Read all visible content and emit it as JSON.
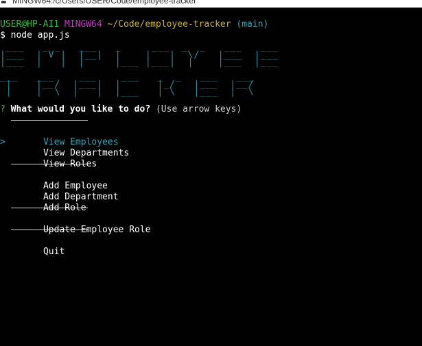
{
  "window": {
    "title": "MINGW64:/c/Users/USER/Code/employee-tracker",
    "icon": "terminal-icon"
  },
  "colors": {
    "background": "#000000",
    "user": "#27c13a",
    "mingw": "#c33bc3",
    "path": "#c8b42f",
    "branch": "#2ea5b8",
    "ascii": "#2a8fa3",
    "selected": "#2ea5b8",
    "question_mark": "#27c13a",
    "text": "#ffffff",
    "hint": "#d0d0d0"
  },
  "prompt": {
    "user_host": "USER@HP-AI1",
    "system": "MINGW64",
    "path": "~/Code/employee-tracker",
    "branch": "(main)",
    "symbol": "$",
    "command": "node app.js"
  },
  "banner": {
    "word1_ascii": " ___   _ _   ___   _     ___  _  _   ___   ___ \n|___  | V |  |__|  |    |   |  \\/   |___  |___ \n|___  |   |  |     |___ |___|  |    |___  |___ ",
    "word2_ascii": "___   ___    ___    ___   _  _   ___   ___ \n |    |__/  |___|  |      |_/   |___  |__/ \n |    |  \\  |   |  |___   | \\   |___  |  \\ "
  },
  "question": {
    "marker": "?",
    "text": "What would you like to do?",
    "hint": "(Use arrow keys)"
  },
  "menu": {
    "pointer": ">",
    "view_employees": "View Employees",
    "view_departments": "View Departments",
    "view_roles": "View Roles",
    "add_employee": "Add Employee",
    "add_department": "Add Department",
    "add_role": "Add Role",
    "update_employee_role": "Update Employee Role",
    "quit": "Quit"
  }
}
